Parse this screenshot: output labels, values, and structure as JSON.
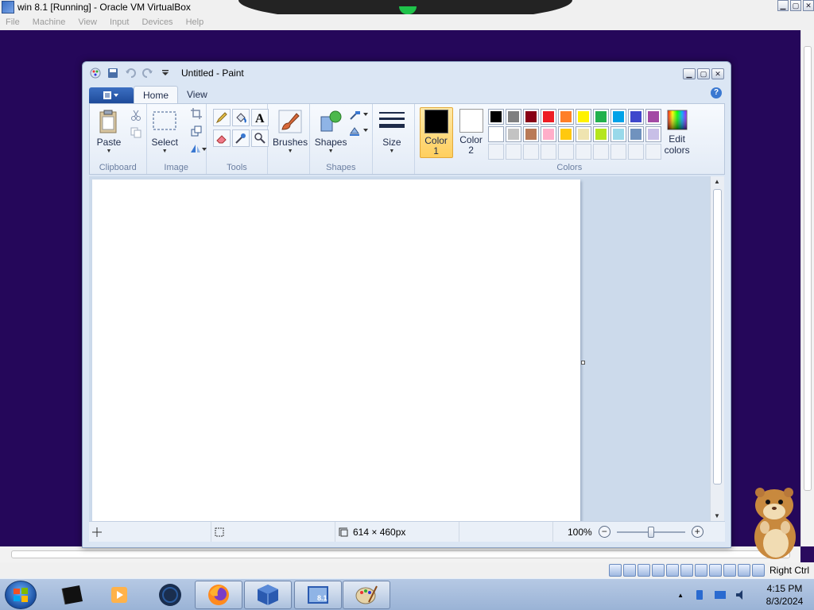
{
  "vbox": {
    "title": "win 8.1 [Running] - Oracle VM VirtualBox",
    "menu": [
      "File",
      "Machine",
      "View",
      "Input",
      "Devices",
      "Help"
    ],
    "host_key": "Right Ctrl"
  },
  "paint": {
    "title": "Untitled - Paint",
    "tabs": [
      "Home",
      "View"
    ],
    "groups": {
      "clipboard": {
        "label": "Clipboard",
        "paste": "Paste"
      },
      "image": {
        "label": "Image",
        "select": "Select"
      },
      "tools": {
        "label": "Tools"
      },
      "brushes": {
        "label": "Brushes"
      },
      "shapes": {
        "label": "Shapes",
        "shapes_btn": "Shapes"
      },
      "size": {
        "label": "Size"
      },
      "colors": {
        "label": "Colors",
        "color1": "Color",
        "color1_num": "1",
        "color2": "Color",
        "color2_num": "2",
        "edit": "Edit",
        "edit2": "colors",
        "color1_value": "#000000",
        "color2_value": "#ffffff",
        "row1": [
          "#000000",
          "#7f7f7f",
          "#880015",
          "#ed1c24",
          "#ff7f27",
          "#fff200",
          "#22b14c",
          "#00a2e8",
          "#3f48cc",
          "#a349a4"
        ],
        "row2": [
          "#ffffff",
          "#c3c3c3",
          "#b97a57",
          "#ffaec9",
          "#ffc90e",
          "#efe4b0",
          "#b5e61d",
          "#99d9ea",
          "#7092be",
          "#c8bfe7"
        ]
      }
    },
    "status": {
      "dimensions": "614 × 460px",
      "zoom": "100%"
    }
  },
  "taskbar": {
    "time": "4:15 PM",
    "date": "8/3/2024"
  }
}
